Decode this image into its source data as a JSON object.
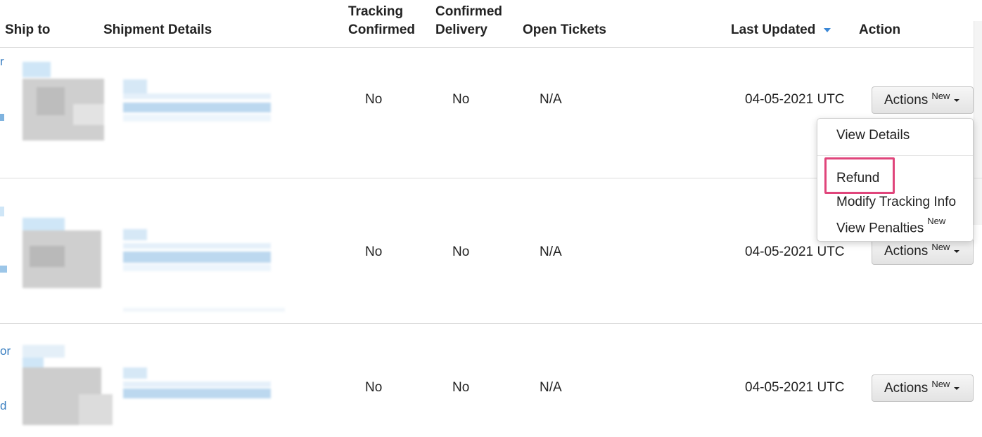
{
  "header": {
    "ship_to": "Ship to",
    "shipment_details": "Shipment Details",
    "tracking_confirmed": [
      "Tracking",
      "Confirmed"
    ],
    "confirmed_delivery": [
      "Confirmed",
      "Delivery"
    ],
    "open_tickets": "Open Tickets",
    "last_updated": "Last Updated",
    "action": "Action"
  },
  "rows": [
    {
      "tracking_confirmed": "No",
      "confirmed_delivery": "No",
      "open_tickets": "N/A",
      "last_updated": "04-05-2021 UTC",
      "action_label": "Actions",
      "action_badge": "New",
      "link_frag_top": "r",
      "link_frag_bottom": ""
    },
    {
      "tracking_confirmed": "No",
      "confirmed_delivery": "No",
      "open_tickets": "N/A",
      "last_updated": "04-05-2021 UTC",
      "action_label": "Actions",
      "action_badge": "New",
      "link_frag_top": "",
      "link_frag_bottom": ""
    },
    {
      "tracking_confirmed": "No",
      "confirmed_delivery": "No",
      "open_tickets": "N/A",
      "last_updated": "04-05-2021 UTC",
      "action_label": "Actions",
      "action_badge": "New",
      "link_frag_top": "or",
      "link_frag_bottom": "d"
    }
  ],
  "dropdown": {
    "view_details": "View Details",
    "refund": "Refund",
    "modify_tracking": "Modify Tracking Info",
    "view_penalties": "View Penalties",
    "view_penalties_badge": "New"
  },
  "colors": {
    "highlight": "#e0457b",
    "link": "#3a7fc1",
    "sort_caret": "#3a87d6"
  }
}
